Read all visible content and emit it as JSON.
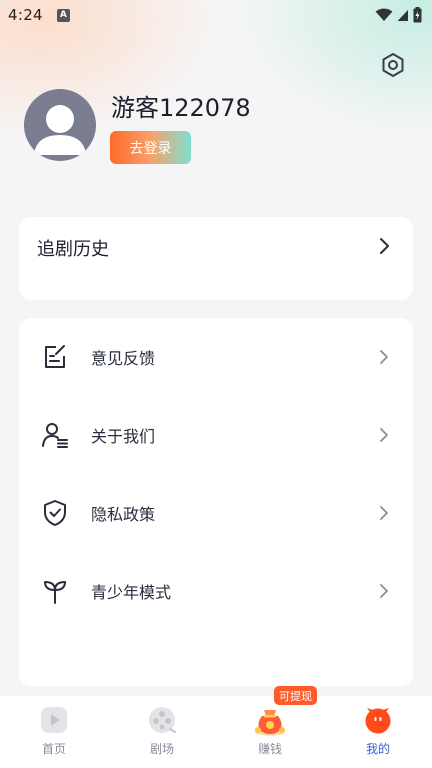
{
  "status_bar": {
    "time": "4:24",
    "notification_letter": "A"
  },
  "profile": {
    "username": "游客122078",
    "login_label": "去登录"
  },
  "history": {
    "title": "追剧历史"
  },
  "menu": {
    "items": [
      {
        "label": "意见反馈",
        "icon": "feedback-icon"
      },
      {
        "label": "关于我们",
        "icon": "about-us-icon"
      },
      {
        "label": "隐私政策",
        "icon": "privacy-shield-icon"
      },
      {
        "label": "青少年模式",
        "icon": "sprout-icon"
      }
    ]
  },
  "tabbar": {
    "tabs": [
      {
        "label": "首页",
        "icon": "play-icon",
        "active": false
      },
      {
        "label": "剧场",
        "icon": "film-reel-icon",
        "active": false
      },
      {
        "label": "赚钱",
        "icon": "money-bag-icon",
        "active": false
      },
      {
        "label": "我的",
        "icon": "mascot-icon",
        "active": true
      }
    ],
    "earn_badge": "可提现"
  },
  "colors": {
    "accent": "#3a5bd9",
    "brand_orange": "#ff5a2a",
    "login_gradient_start": "#ff6a2a",
    "login_gradient_end": "#7ee0cf"
  }
}
